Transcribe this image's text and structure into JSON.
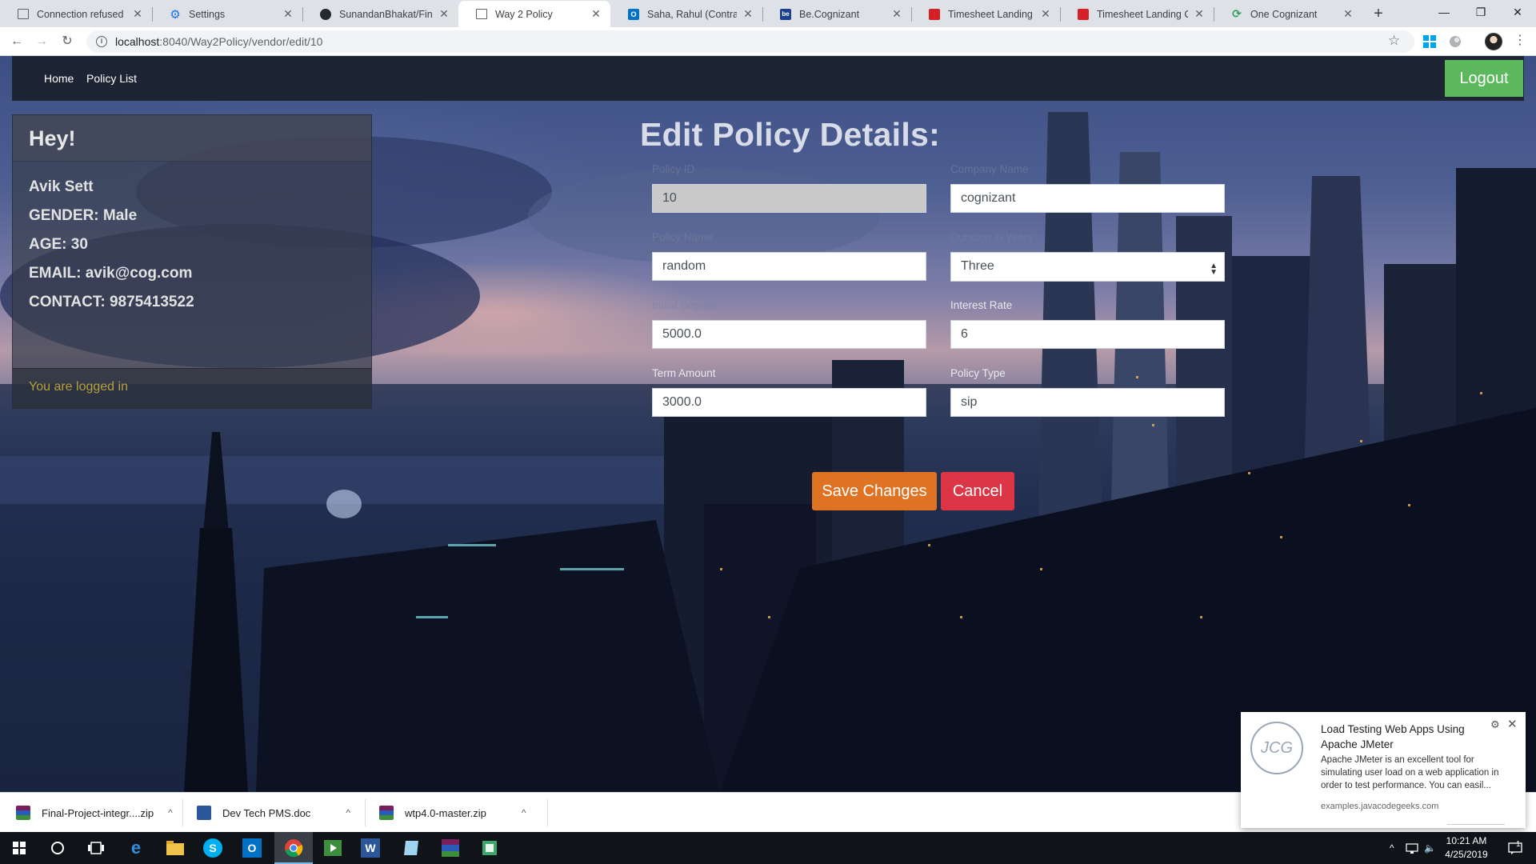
{
  "browser": {
    "tabs": [
      {
        "title": "Connection refused",
        "icon": "page-icon",
        "active": false
      },
      {
        "title": "Settings",
        "icon": "gear-icon",
        "active": false
      },
      {
        "title": "SunandanBhakat/Final-",
        "icon": "github-icon",
        "active": false
      },
      {
        "title": "Way 2 Policy",
        "icon": "page-icon",
        "active": true
      },
      {
        "title": "Saha, Rahul (Contractor",
        "icon": "outlook-icon",
        "active": false
      },
      {
        "title": "Be.Cognizant",
        "icon": "be-icon",
        "active": false
      },
      {
        "title": "Timesheet Landing Con",
        "icon": "timesheet-icon",
        "active": false
      },
      {
        "title": "Timesheet Landing Con",
        "icon": "timesheet-icon",
        "active": false
      },
      {
        "title": "One Cognizant",
        "icon": "onecognizant-icon",
        "active": false
      }
    ],
    "url_host": "localhost",
    "url_path": ":8040/Way2Policy/vendor/edit/10"
  },
  "navbar": {
    "home": "Home",
    "policy_list": "Policy List",
    "logout": "Logout"
  },
  "profile": {
    "greeting": "Hey!",
    "name": "Avik  Sett",
    "gender": "GENDER: Male",
    "age": "AGE: 30",
    "email": "EMAIL: avik@cog.com",
    "contact": "CONTACT: 9875413522",
    "status": "You are logged in"
  },
  "form": {
    "title": "Edit Policy Details:",
    "policy_id": {
      "label": "Policy ID",
      "value": "10"
    },
    "company_name": {
      "label": "Company Name",
      "value": "cognizant"
    },
    "policy_name": {
      "label": "Policy Name",
      "value": "random"
    },
    "duration": {
      "label": "Duration in Years",
      "value": "Three"
    },
    "initial_deposit": {
      "label": "Initial Deposit",
      "value": "5000.0"
    },
    "interest_rate": {
      "label": "Interest Rate",
      "value": "6"
    },
    "term_amount": {
      "label": "Term Amount",
      "value": "3000.0"
    },
    "policy_type": {
      "label": "Policy Type",
      "value": "sip"
    },
    "save": "Save Changes",
    "cancel": "Cancel"
  },
  "notification": {
    "logo": "JCG",
    "title": "Load Testing Web Apps Using Apache JMeter",
    "text": "Apache JMeter is an excellent tool for simulating user load on a web application in order to test performance. You can easil...",
    "source": "examples.javacodegeeks.com"
  },
  "downloads": [
    {
      "name": "Final-Project-integr....zip",
      "icon": "winrar-icon"
    },
    {
      "name": "Dev Tech PMS.doc",
      "icon": "word-doc-icon"
    },
    {
      "name": "wtp4.0-master.zip",
      "icon": "winrar-icon"
    }
  ],
  "taskbar": {
    "time": "10:21 AM",
    "date": "4/25/2019",
    "notification_count": "1"
  },
  "colors": {
    "logout_green": "#5cb85c",
    "save_orange": "#e07323",
    "cancel_red": "#dc3545",
    "navbar_dark": "#1d2534",
    "logged_in_gold": "#b8a040"
  }
}
